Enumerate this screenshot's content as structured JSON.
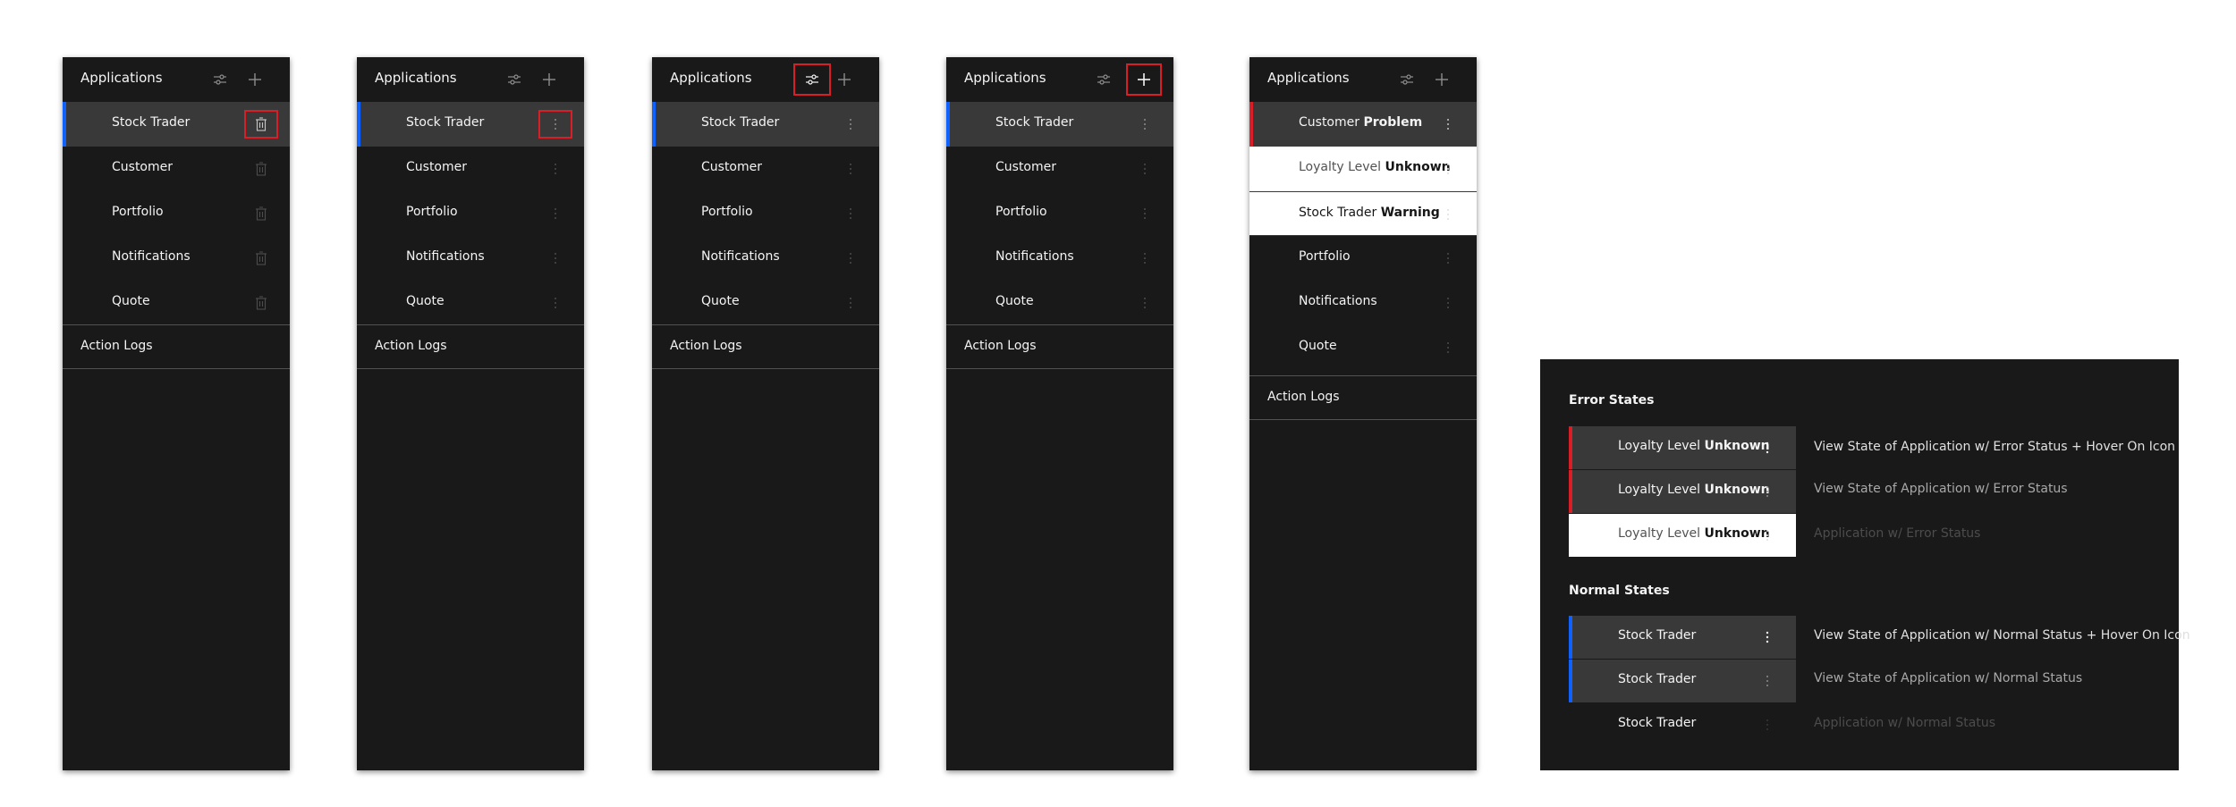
{
  "colors": {
    "panel_bg": "#191919",
    "selected_bg": "#393939",
    "selected_accent": "#0f62fe",
    "error_accent": "#da1e28",
    "highlight_outline": "#da1e28"
  },
  "header": {
    "title": "Applications",
    "settings_icon": "settings-adjust-icon",
    "add_icon": "add-icon"
  },
  "action_logs": "Action Logs",
  "panel1": {
    "row_icon": "trash-can-icon",
    "items": [
      "Stock Trader",
      "Customer",
      "Portfolio",
      "Notifications",
      "Quote"
    ]
  },
  "panel2": {
    "row_icon": "overflow-menu-vertical-icon",
    "items": [
      "Stock Trader",
      "Customer",
      "Portfolio",
      "Notifications",
      "Quote"
    ]
  },
  "panel3": {
    "row_icon": "overflow-menu-vertical-icon",
    "items": [
      "Stock Trader",
      "Customer",
      "Portfolio",
      "Notifications",
      "Quote"
    ]
  },
  "panel4": {
    "row_icon": "overflow-menu-vertical-icon",
    "items": [
      "Stock Trader",
      "Customer",
      "Portfolio",
      "Notifications",
      "Quote"
    ]
  },
  "panel5": {
    "row_icon": "overflow-menu-vertical-icon",
    "items": [
      {
        "name": "Customer",
        "status": "Problem"
      },
      {
        "name": "Loyalty Level",
        "status": "Unknown"
      },
      {
        "name": "Stock Trader",
        "status": "Warning"
      },
      {
        "name": "Portfolio"
      },
      {
        "name": "Notifications"
      },
      {
        "name": "Quote"
      }
    ]
  },
  "legend": {
    "error_heading": "Error States",
    "normal_heading": "Normal States",
    "error_rows": [
      {
        "name": "Loyalty Level",
        "status": "Unknown",
        "desc": "View State of Application w/ Error Status + Hover On Icon"
      },
      {
        "name": "Loyalty Level",
        "status": "Unknown",
        "desc": "View State of Application w/ Error Status"
      },
      {
        "name": "Loyalty Level",
        "status": "Unknown",
        "desc": "Application w/ Error Status"
      }
    ],
    "normal_rows": [
      {
        "name": "Stock Trader",
        "desc": "View State of Application w/ Normal Status + Hover On Icon"
      },
      {
        "name": "Stock Trader",
        "desc": "View State of Application w/ Normal Status"
      },
      {
        "name": "Stock Trader",
        "desc": "Application w/ Normal Status"
      }
    ]
  }
}
